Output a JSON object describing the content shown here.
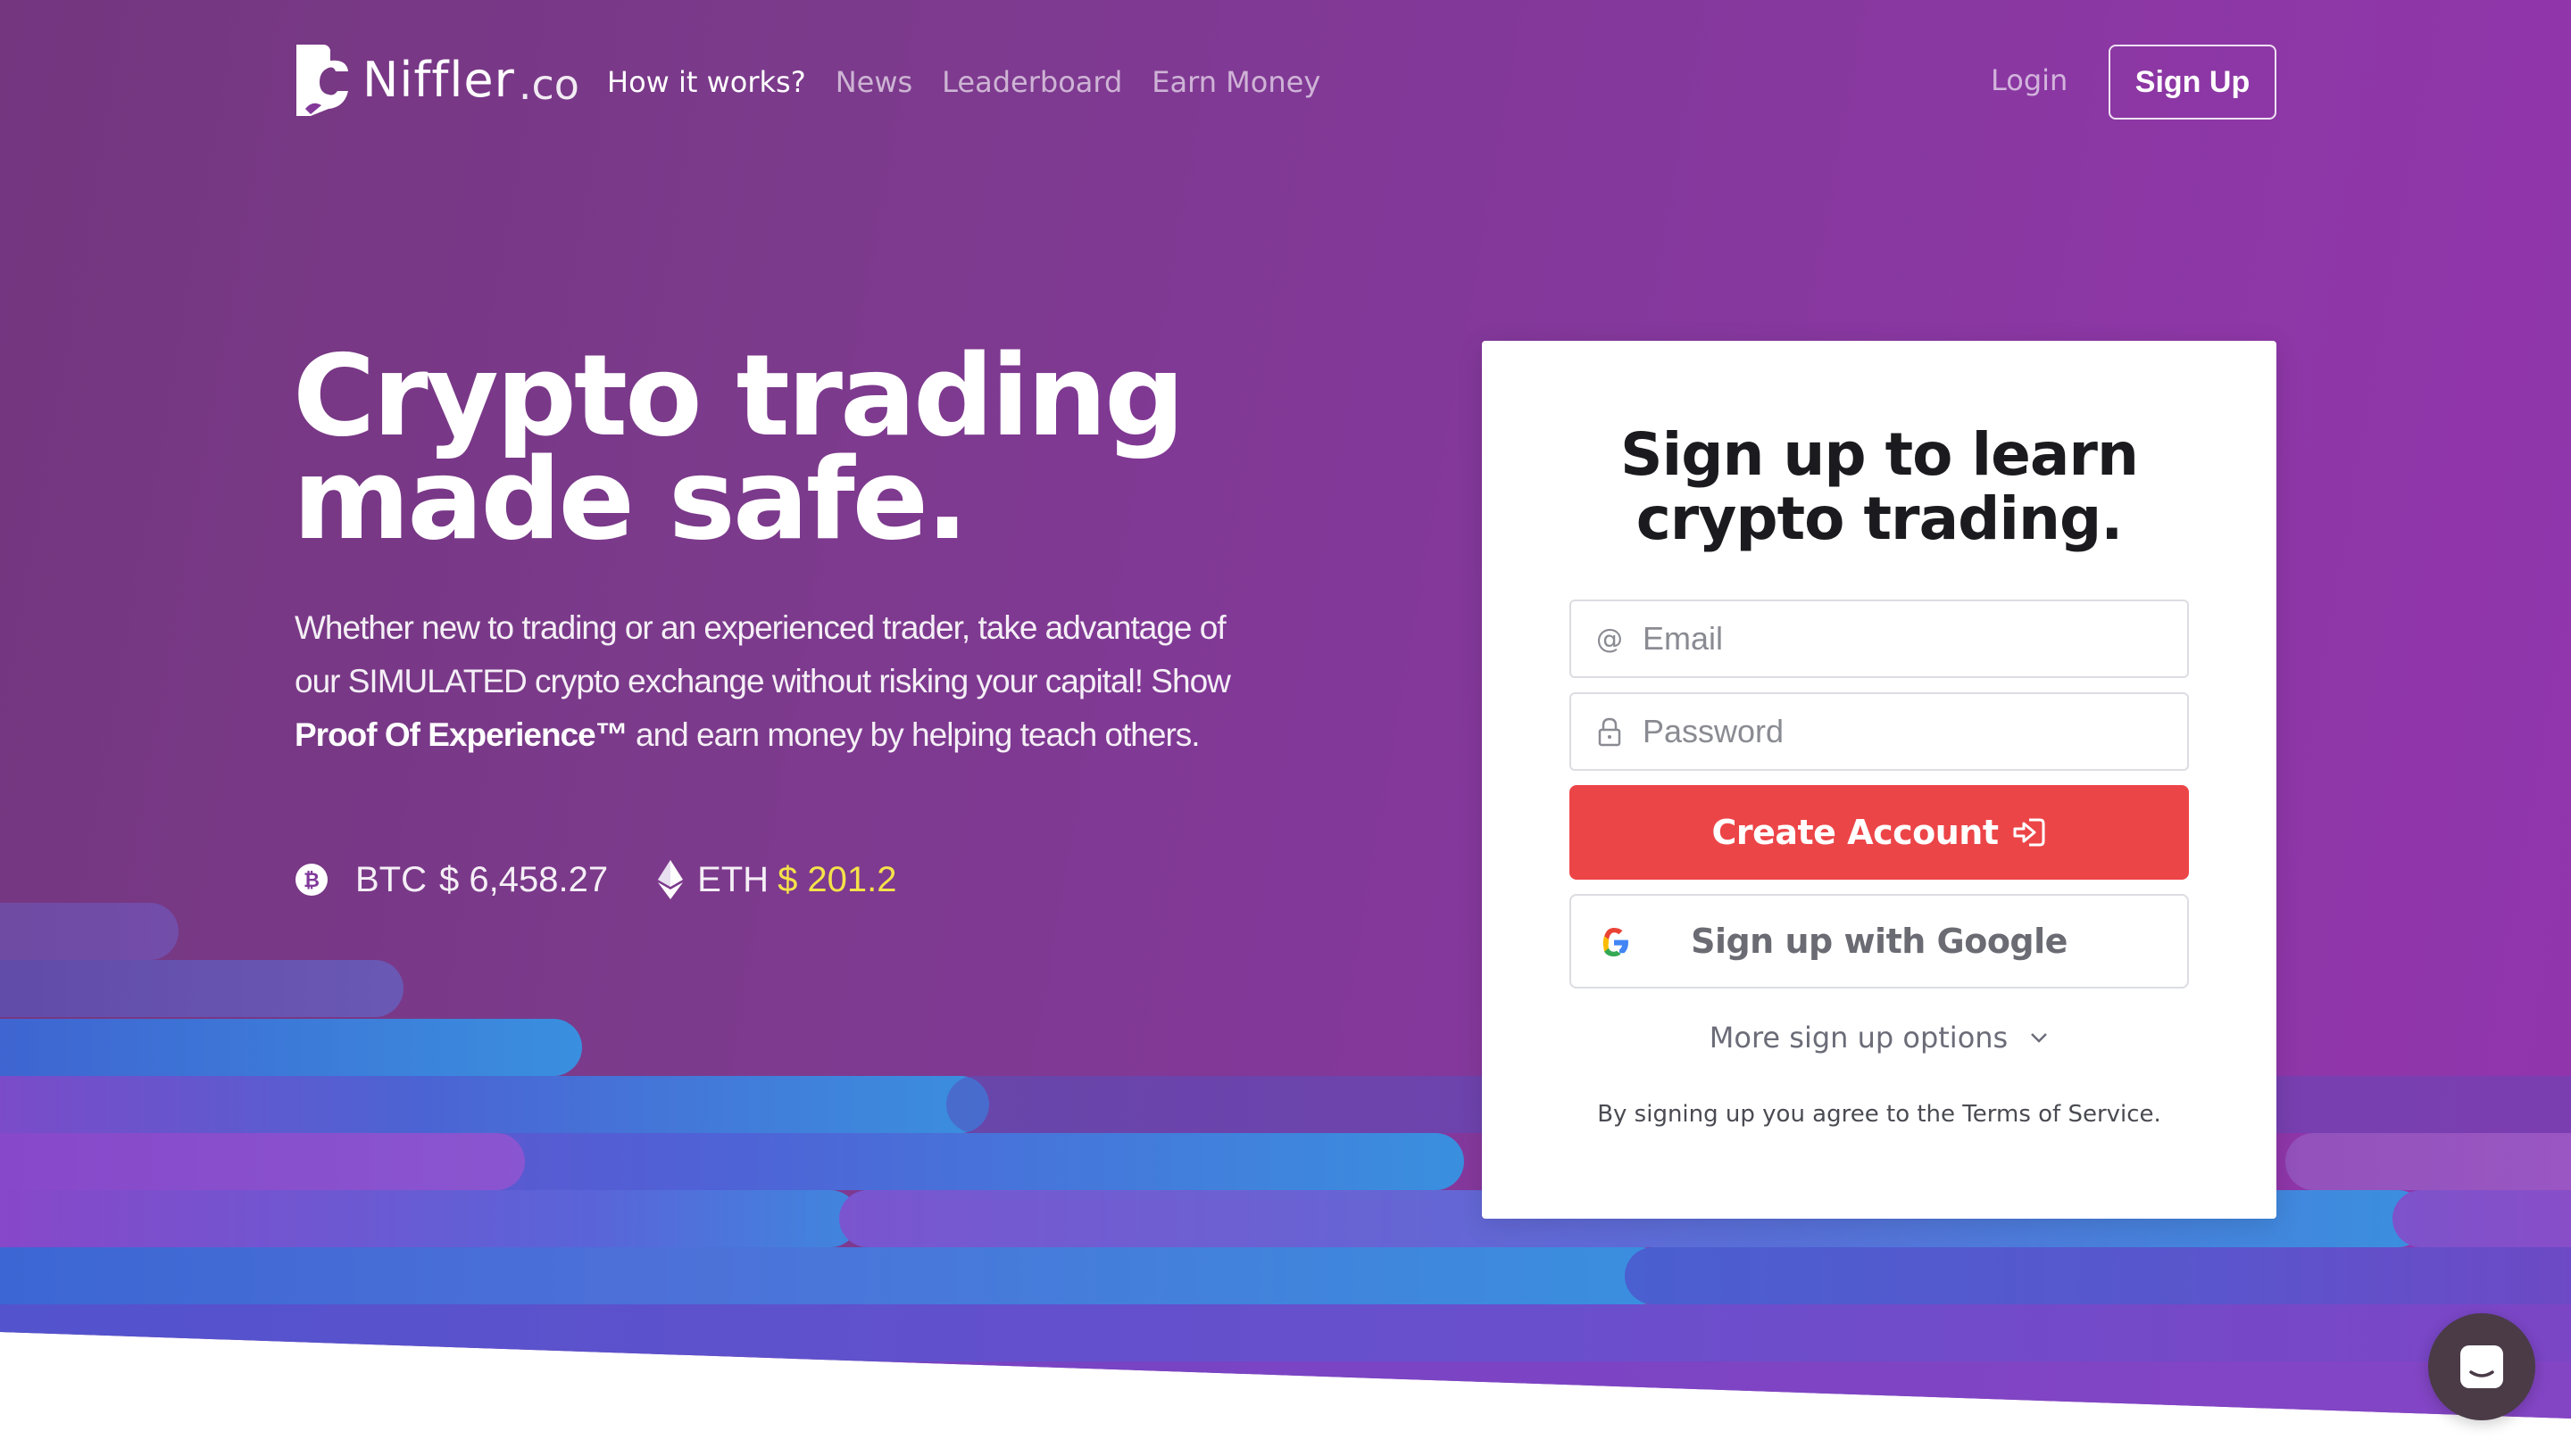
{
  "brand": {
    "name": "Niffler",
    "tld": ".co"
  },
  "nav": {
    "links": [
      "How it works?",
      "News",
      "Leaderboard",
      "Earn Money"
    ],
    "login": "Login",
    "signup": "Sign Up"
  },
  "hero": {
    "headline_line1": "Crypto trading",
    "headline_line2": "made safe.",
    "sub_part1": "Whether new to trading or an experienced trader, take advantage of our SIMULATED crypto exchange without risking your capital!  Show ",
    "sub_bold": "Proof Of Experience™",
    "sub_part2": " and earn money by helping teach others."
  },
  "prices": {
    "btc_label": "BTC",
    "btc_value": "$ 6,458.27",
    "eth_label": "ETH",
    "eth_value": "$ 201.2"
  },
  "signup_card": {
    "title_line1": "Sign up to learn",
    "title_line2": "crypto trading.",
    "email_placeholder": "Email",
    "password_placeholder": "Password",
    "create_account": "Create Account",
    "google": "Sign up with Google",
    "more_options": "More sign up options",
    "terms_prefix": "By signing up you agree to the ",
    "terms_link": "Terms of Service",
    "terms_suffix": "."
  },
  "colors": {
    "hero_bg": "#83389a",
    "cta_red": "#ec4548",
    "eth_price": "#f4e24a",
    "streak_blue": "#3a8fdf",
    "streak_purple": "#7a48c9"
  },
  "icons": {
    "btc": "bitcoin-icon",
    "eth": "ethereum-icon",
    "email": "at-icon",
    "password": "lock-icon",
    "create": "sign-in-icon",
    "google": "google-icon",
    "chevron": "chevron-down-icon",
    "chat": "chat-icon"
  }
}
